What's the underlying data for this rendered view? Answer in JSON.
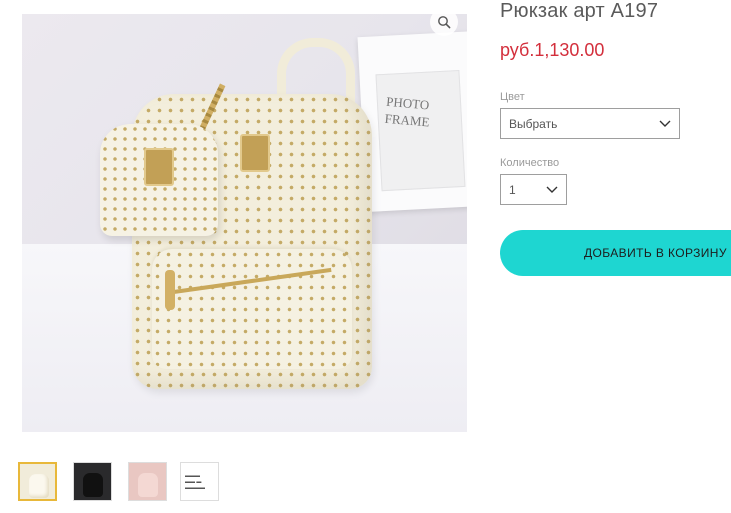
{
  "product": {
    "title": "Рюкзак арт А197",
    "price": "руб.1,130.00"
  },
  "options": {
    "color_label": "Цвет",
    "color_value": "Выбрать",
    "quantity_label": "Количество",
    "quantity_value": "1"
  },
  "actions": {
    "add_to_cart_label": "ДОБАВИТЬ В КОРЗИНУ"
  },
  "gallery": {
    "main_image_icon": "zoom-icon",
    "photo_frame_text": "PHOTO\nFRAME",
    "thumbnails": [
      {
        "name": "thumb-white-backpack",
        "color": "#f1ecda",
        "selected": true
      },
      {
        "name": "thumb-black-backpack",
        "color": "#2a2a2c",
        "selected": false
      },
      {
        "name": "thumb-pink-backpack",
        "color": "#e9c7c2",
        "selected": false
      },
      {
        "name": "thumb-size-chart",
        "color": "#ffffff",
        "selected": false
      }
    ]
  },
  "colors": {
    "price": "#d32f3c",
    "cart_button": "#1ed6d1",
    "thumb_selected_border": "#e8b83a"
  }
}
